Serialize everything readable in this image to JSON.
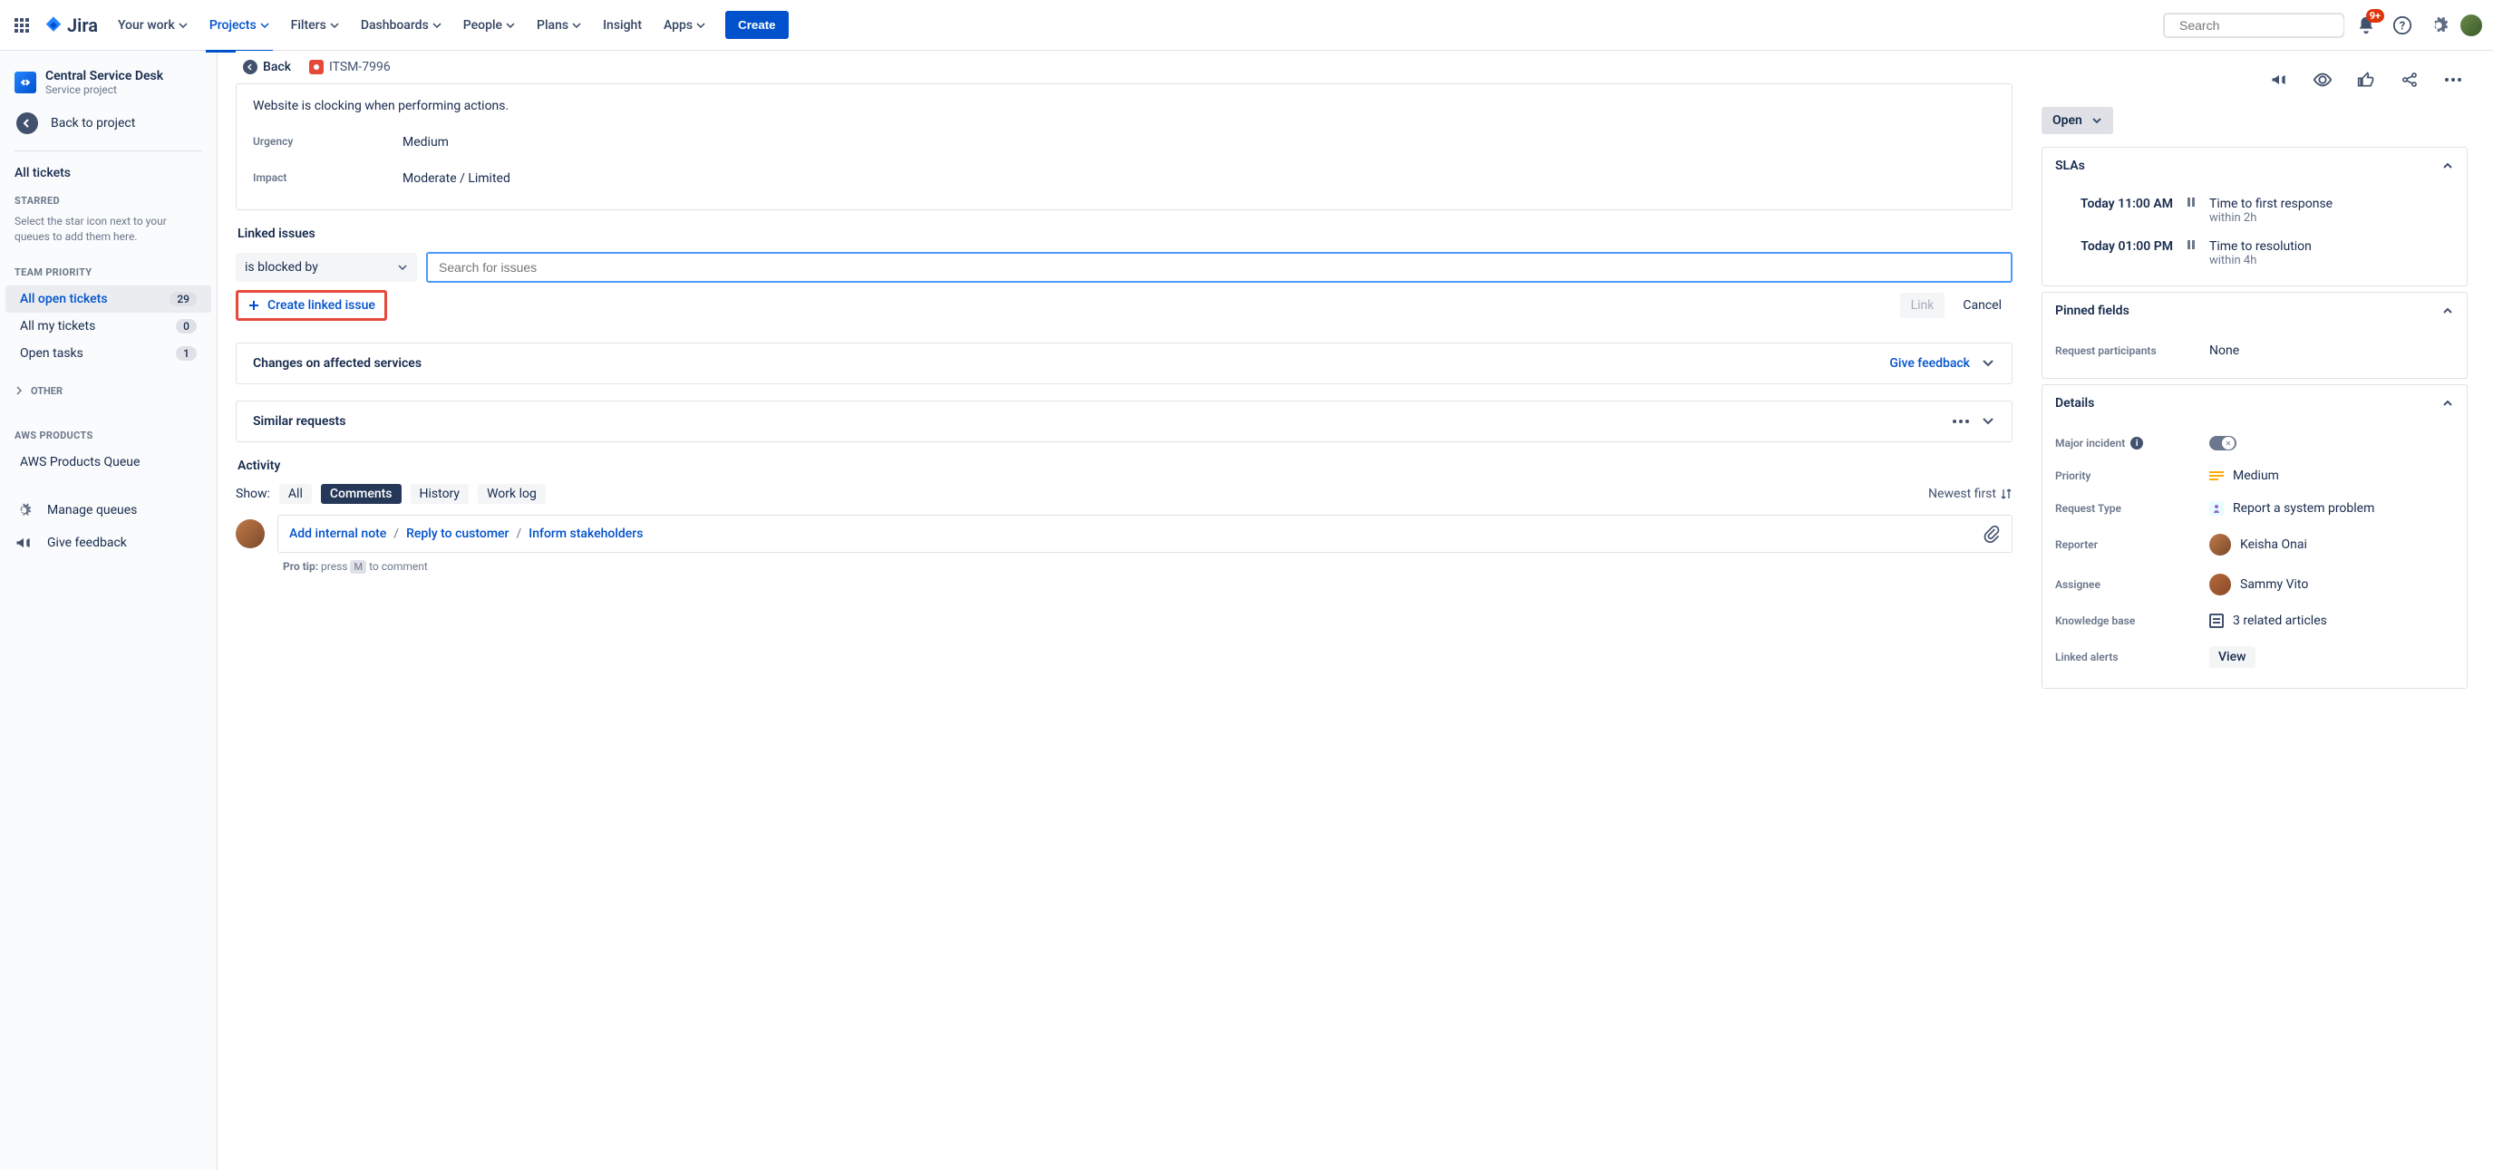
{
  "nav": {
    "logo": "Jira",
    "items": [
      "Your work",
      "Projects",
      "Filters",
      "Dashboards",
      "People",
      "Plans",
      "Insight",
      "Apps"
    ],
    "active_index": 1,
    "create": "Create",
    "search_placeholder": "Search",
    "notif_badge": "9+"
  },
  "sidebar": {
    "project_name": "Central Service Desk",
    "project_type": "Service project",
    "back": "Back to project",
    "all_tickets": "All tickets",
    "starred_hdr": "STARRED",
    "starred_help": "Select the star icon next to your queues to add them here.",
    "team_hdr": "TEAM PRIORITY",
    "queues": [
      {
        "label": "All open tickets",
        "count": "29",
        "active": true
      },
      {
        "label": "All my tickets",
        "count": "0"
      },
      {
        "label": "Open tasks",
        "count": "1"
      }
    ],
    "other": "OTHER",
    "aws_hdr": "AWS PRODUCTS",
    "aws_queue": "AWS Products Queue",
    "manage": "Manage queues",
    "feedback": "Give feedback"
  },
  "main": {
    "back": "Back",
    "issue_key": "ITSM-7996",
    "description": "Website is clocking when performing actions.",
    "fields": [
      {
        "label": "Urgency",
        "value": "Medium"
      },
      {
        "label": "Impact",
        "value": "Moderate / Limited"
      }
    ],
    "linked_issues_hdr": "Linked issues",
    "link_type": "is blocked by",
    "search_placeholder": "Search for issues",
    "create_linked": "Create linked issue",
    "link_btn": "Link",
    "cancel_btn": "Cancel",
    "changes_hdr": "Changes on affected services",
    "give_feedback": "Give feedback",
    "similar_hdr": "Similar requests",
    "activity_hdr": "Activity",
    "show_label": "Show:",
    "tabs": [
      "All",
      "Comments",
      "History",
      "Work log"
    ],
    "active_tab": 1,
    "newest": "Newest first",
    "comment_actions": [
      "Add internal note",
      "Reply to customer",
      "Inform stakeholders"
    ],
    "tip_prefix": "Pro tip:",
    "tip_press": " press ",
    "tip_key": "M",
    "tip_suffix": " to comment"
  },
  "right": {
    "status": "Open",
    "slas_hdr": "SLAs",
    "slas": [
      {
        "time": "Today 11:00 AM",
        "title": "Time to first response",
        "sub": "within 2h"
      },
      {
        "time": "Today 01:00 PM",
        "title": "Time to resolution",
        "sub": "within 4h"
      }
    ],
    "pinned_hdr": "Pinned fields",
    "participants_lbl": "Request participants",
    "participants_val": "None",
    "details_hdr": "Details",
    "details": {
      "major_lbl": "Major incident",
      "priority_lbl": "Priority",
      "priority_val": "Medium",
      "req_type_lbl": "Request Type",
      "req_type_val": "Report a system problem",
      "reporter_lbl": "Reporter",
      "reporter_val": "Keisha Onai",
      "assignee_lbl": "Assignee",
      "assignee_val": "Sammy Vito",
      "kb_lbl": "Knowledge base",
      "kb_val": "3 related articles",
      "alerts_lbl": "Linked alerts",
      "alerts_val": "View"
    }
  }
}
